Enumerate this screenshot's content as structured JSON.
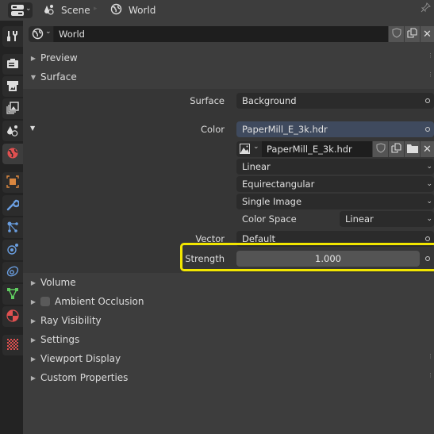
{
  "header": {
    "editor_icon": "properties-editor-icon",
    "breadcrumb": [
      {
        "icon": "scene-icon",
        "label": "Scene"
      },
      {
        "icon": "world-icon",
        "label": "World"
      }
    ],
    "pin_icon": "pin-icon"
  },
  "sidebar": {
    "tabs": [
      {
        "name": "tool",
        "icon": "tool-icon",
        "active": false
      },
      {
        "name": "render",
        "icon": "render-icon",
        "active": false
      },
      {
        "name": "output",
        "icon": "output-icon",
        "active": false
      },
      {
        "name": "view-layer",
        "icon": "view-layer-icon",
        "active": false
      },
      {
        "name": "scene",
        "icon": "scene-icon",
        "active": false
      },
      {
        "name": "world",
        "icon": "world-icon",
        "active": true
      },
      {
        "name": "object",
        "icon": "object-icon",
        "active": false
      },
      {
        "name": "modifiers",
        "icon": "wrench-icon",
        "active": false
      },
      {
        "name": "particles",
        "icon": "particles-icon",
        "active": false
      },
      {
        "name": "physics",
        "icon": "physics-icon",
        "active": false
      },
      {
        "name": "constraints",
        "icon": "constraints-icon",
        "active": false
      },
      {
        "name": "data",
        "icon": "mesh-data-icon",
        "active": false
      },
      {
        "name": "material",
        "icon": "material-icon",
        "active": false
      },
      {
        "name": "texture",
        "icon": "texture-icon",
        "active": false
      }
    ]
  },
  "world_selector": {
    "name": "World"
  },
  "panels": {
    "preview": {
      "label": "Preview",
      "expanded": false
    },
    "surface": {
      "label": "Surface",
      "expanded": true,
      "surface_label": "Surface",
      "surface_value": "Background",
      "color_label": "Color",
      "color_value": "PaperMill_E_3k.hdr",
      "image_name": "PaperMill_E_3k.hdr",
      "interpolation": "Linear",
      "projection": "Equirectangular",
      "source": "Single Image",
      "color_space_label": "Color Space",
      "color_space_value": "Linear",
      "vector_label": "Vector",
      "vector_value": "Default",
      "strength_label": "Strength",
      "strength_value": "1.000"
    },
    "collapsed": [
      {
        "label": "Volume"
      },
      {
        "label": "Ambient Occlusion",
        "checkbox": false
      },
      {
        "label": "Ray Visibility"
      },
      {
        "label": "Settings"
      },
      {
        "label": "Viewport Display"
      },
      {
        "label": "Custom Properties"
      }
    ]
  },
  "colors": {
    "highlight": "#f2e600",
    "color_field": "#3f4a5e",
    "world_icon_active": "#e05050"
  }
}
